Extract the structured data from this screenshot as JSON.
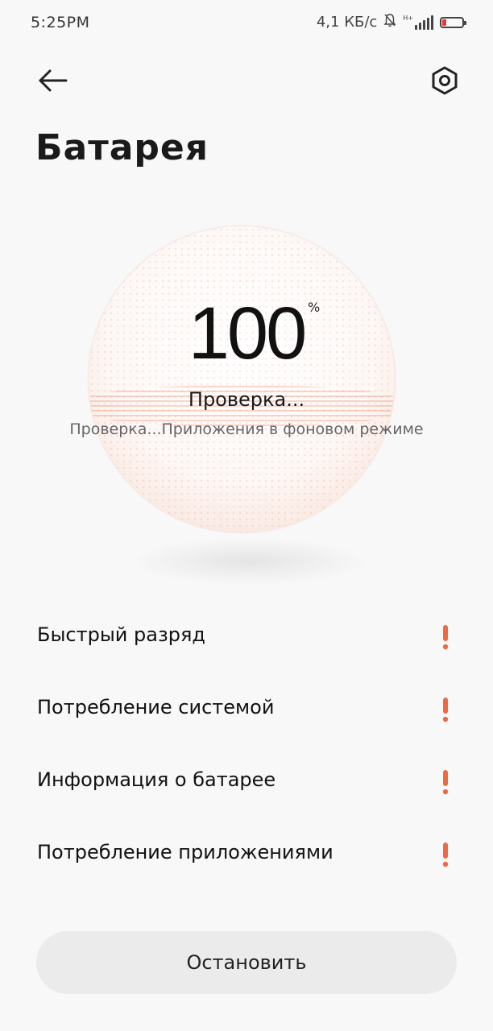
{
  "status_bar": {
    "time": "5:25PM",
    "network_speed": "4,1 КБ/с",
    "network_type": "H+",
    "icons": [
      "mute-icon",
      "signal-icon",
      "battery-icon"
    ],
    "battery_color": "#e53935"
  },
  "toolbar": {
    "back_icon": "arrow-left-icon",
    "settings_icon": "settings-hex-icon"
  },
  "page": {
    "title": "Батарея"
  },
  "battery": {
    "percent": "100",
    "percent_sign": "%",
    "status": "Проверка...",
    "detail": "Проверка...Приложения в фоновом режиме"
  },
  "checks": {
    "items": [
      {
        "label": "Быстрый разряд",
        "icon": "warning-icon"
      },
      {
        "label": "Потребление системой",
        "icon": "warning-icon"
      },
      {
        "label": "Информация о батарее",
        "icon": "warning-icon"
      },
      {
        "label": "Потребление приложениями",
        "icon": "warning-icon"
      }
    ],
    "warning_color": "#ee6a45"
  },
  "actions": {
    "stop_label": "Остановить"
  }
}
